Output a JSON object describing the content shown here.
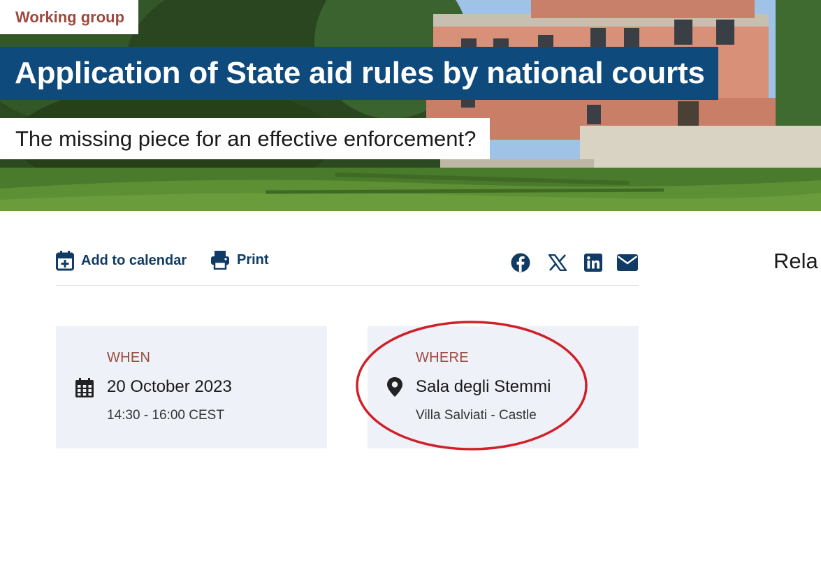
{
  "hero": {
    "tag": "Working group",
    "title": "Application of State aid rules by national courts",
    "subtitle": "The missing piece for an effective enforcement?"
  },
  "actions": {
    "add_to_calendar": "Add to calendar",
    "print": "Print"
  },
  "share": {
    "icons": [
      "facebook-icon",
      "x-icon",
      "linkedin-icon",
      "mail-icon"
    ]
  },
  "sidebar": {
    "heading_partial": "Rela"
  },
  "when": {
    "label": "WHEN",
    "date": "20 October 2023",
    "time": "14:30 - 16:00 CEST"
  },
  "where": {
    "label": "WHERE",
    "room": "Sala degli Stemmi",
    "building": "Villa Salviati - Castle"
  },
  "colors": {
    "brand_blue": "#0f4a7d",
    "accent_red": "#9c4a3f",
    "card_bg": "#eef2f8",
    "annotation": "#d0202a"
  }
}
